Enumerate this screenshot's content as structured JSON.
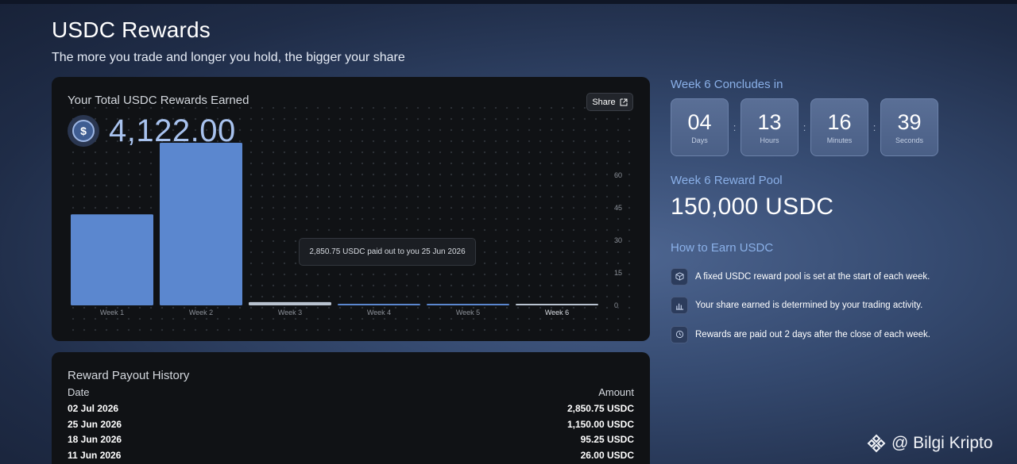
{
  "header": {
    "title": "USDC Rewards",
    "subtitle": "The more you trade and longer you hold, the bigger your share"
  },
  "rewards_card": {
    "label": "Your Total USDC Rewards Earned",
    "share_label": "Share",
    "total": "4,122.00",
    "tooltip": "2,850.75 USDC paid out to you 25 Jun 2026"
  },
  "chart_data": {
    "type": "bar",
    "categories": [
      "Week 1",
      "Week 2",
      "Week 3",
      "Week 4",
      "Week 5",
      "Week 6"
    ],
    "values": [
      42,
      75,
      1.5,
      0.6,
      0.6,
      0.6
    ],
    "ylim": [
      0,
      60
    ],
    "yticks": [
      "60",
      "45",
      "30",
      "15",
      "0"
    ],
    "active_category": "Week 6",
    "grid": "dots"
  },
  "history": {
    "title": "Reward Payout History",
    "col_date": "Date",
    "col_amount": "Amount",
    "rows": [
      {
        "date": "02 Jul 2026",
        "amount": "2,850.75 USDC"
      },
      {
        "date": "25 Jun 2026",
        "amount": "1,150.00 USDC"
      },
      {
        "date": "18 Jun 2026",
        "amount": "95.25 USDC"
      },
      {
        "date": "11 Jun 2026",
        "amount": "26.00 USDC"
      }
    ]
  },
  "countdown": {
    "label": "Week 6 Concludes in",
    "items": [
      {
        "value": "04",
        "unit": "Days"
      },
      {
        "value": "13",
        "unit": "Hours"
      },
      {
        "value": "16",
        "unit": "Minutes"
      },
      {
        "value": "39",
        "unit": "Seconds"
      }
    ],
    "separator": ":"
  },
  "pool": {
    "label": "Week 6 Reward Pool",
    "value": "150,000 USDC"
  },
  "how_to_earn": {
    "title": "How to Earn USDC",
    "items": [
      {
        "icon": "cube-icon",
        "text": "A fixed USDC reward pool is set at the start of each week."
      },
      {
        "icon": "chart-icon",
        "text": "Your share earned is determined by your trading activity."
      },
      {
        "icon": "clock-icon",
        "text": "Rewards are paid out 2 days after the close of each week."
      }
    ]
  },
  "watermark": {
    "text": "@ Bilgi Kripto"
  },
  "colors": {
    "accent": "#8ab0e8",
    "bar": "#5b87cf",
    "card": "#101215"
  }
}
